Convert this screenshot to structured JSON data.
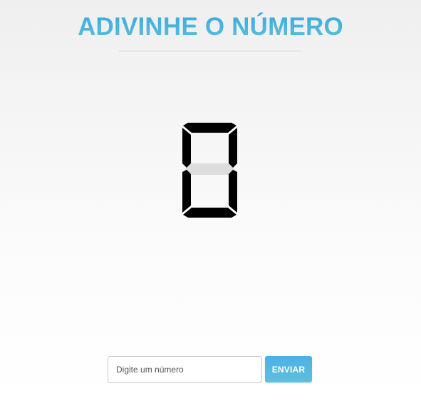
{
  "header": {
    "title": "ADIVINHE O NÚMERO"
  },
  "display": {
    "digit": "0",
    "active_color": "#000000",
    "inactive_color": "#dddddd"
  },
  "form": {
    "input_value": "",
    "input_placeholder": "Digite um número",
    "submit_label": "ENVIAR"
  },
  "colors": {
    "title_gradient_start": "#36a6e0",
    "title_gradient_end": "#5fc4d9",
    "button_gradient_start": "#4db0e4",
    "button_gradient_end": "#5ec0da"
  }
}
